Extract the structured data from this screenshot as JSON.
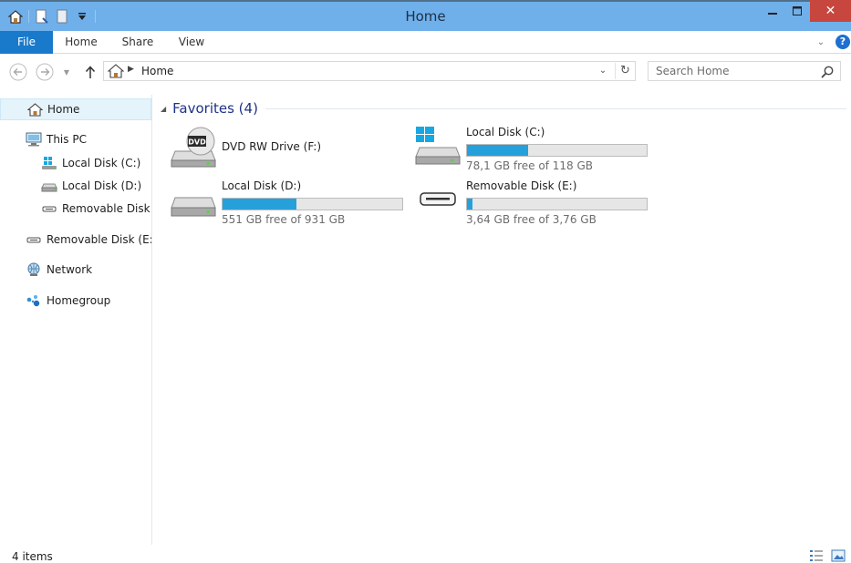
{
  "window": {
    "title": "Home",
    "qat_icons": [
      "home-icon",
      "properties-icon",
      "new-folder-icon",
      "customize-qat-icon"
    ],
    "close_glyph": "✕",
    "minimize_glyph": "—",
    "maximize_glyph": "☐"
  },
  "ribbon": {
    "tabs": [
      {
        "label": "File",
        "active": true
      },
      {
        "label": "Home"
      },
      {
        "label": "Share"
      },
      {
        "label": "View"
      }
    ],
    "help_glyph": "?"
  },
  "navbar": {
    "address": "Home",
    "search_placeholder": "Search Home"
  },
  "navpane": {
    "items": [
      {
        "label": "Home",
        "icon": "home-icon",
        "selected": true
      },
      {
        "label": "This PC",
        "icon": "computer-icon"
      },
      {
        "label": "Local Disk (C:)",
        "icon": "system-drive-icon"
      },
      {
        "label": "Local Disk (D:)",
        "icon": "hard-drive-icon"
      },
      {
        "label": "Removable Disk (",
        "icon": "removable-drive-icon"
      },
      {
        "label": "Removable Disk (E:)",
        "icon": "removable-drive-icon"
      },
      {
        "label": "Network",
        "icon": "network-icon"
      },
      {
        "label": "Homegroup",
        "icon": "homegroup-icon"
      }
    ]
  },
  "content": {
    "group_title": "Favorites (4)",
    "drives": [
      {
        "name": "DVD RW Drive (F:)",
        "icon": "dvd-drive-icon"
      },
      {
        "name": "Local Disk (C:)",
        "free_text": "78,1 GB free of 118 GB",
        "used_fraction": 0.34,
        "icon": "system-drive-icon"
      },
      {
        "name": "Local Disk (D:)",
        "free_text": "551 GB free of 931 GB",
        "used_fraction": 0.41,
        "icon": "hard-drive-icon"
      },
      {
        "name": "Removable Disk (E:)",
        "free_text": "3,64 GB free of 3,76 GB",
        "used_fraction": 0.03,
        "icon": "removable-drive-icon"
      }
    ]
  },
  "statusbar": {
    "items_text": "4 items"
  },
  "colors": {
    "accent": "#1979ca",
    "titlebar": "#6fb0eb",
    "close": "#c7473e",
    "bar_fill": "#26a0da",
    "group_title": "#1e3287"
  }
}
